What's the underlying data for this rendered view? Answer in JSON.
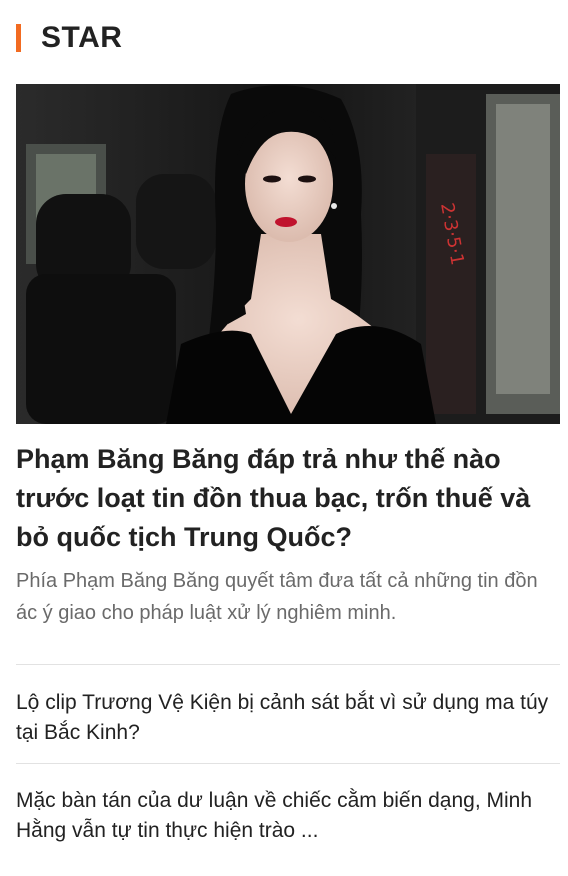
{
  "section": {
    "title": "STAR",
    "accent_color": "#f26b21"
  },
  "featured": {
    "image_icon": "photo-woman-in-black-dress-in-car",
    "headline": "Phạm Băng Băng đáp trả như thế nào trước loạt tin đồn thua bạc, trốn thuế và bỏ quốc tịch Trung Quốc?",
    "summary": "Phía Phạm Băng Băng quyết tâm đưa tất cả những tin đồn ác ý giao cho pháp luật xử lý nghiêm minh."
  },
  "related": [
    {
      "title": "Lộ clip Trương Vệ Kiện bị cảnh sát bắt vì sử dụng ma túy tại Bắc Kinh?"
    },
    {
      "title": "Mặc bàn tán của dư luận về chiếc cằm biến dạng, Minh Hằng vẫn tự tin thực hiện trào ..."
    }
  ]
}
